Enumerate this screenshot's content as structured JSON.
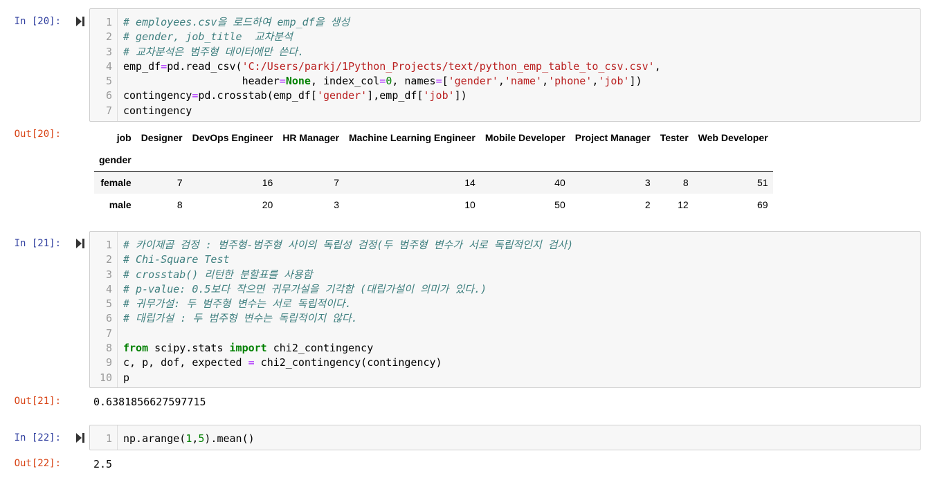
{
  "cells": [
    {
      "in_prompt": "In [20]:",
      "out_prompt": "Out[20]:",
      "lines": [
        {
          "n": "1",
          "parts": [
            {
              "t": "# employees.csv을 로드하여 emp_df을 생성",
              "c": "c-comment"
            }
          ]
        },
        {
          "n": "2",
          "parts": [
            {
              "t": "# gender, job_title  교차분석",
              "c": "c-comment"
            }
          ]
        },
        {
          "n": "3",
          "parts": [
            {
              "t": "# 교차분석은 범주형 데이터에만 쓴다.",
              "c": "c-comment"
            }
          ]
        },
        {
          "n": "4",
          "parts": [
            {
              "t": "emp_df",
              "c": ""
            },
            {
              "t": "=",
              "c": "c-op"
            },
            {
              "t": "pd.read_csv(",
              "c": ""
            },
            {
              "t": "'C:/Users/parkj/1Python_Projects/text/python_emp_table_to_csv.csv'",
              "c": "c-string"
            },
            {
              "t": ",",
              "c": ""
            }
          ]
        },
        {
          "n": "5",
          "parts": [
            {
              "t": "                   header",
              "c": ""
            },
            {
              "t": "=",
              "c": "c-op"
            },
            {
              "t": "None",
              "c": "c-keyword"
            },
            {
              "t": ", index_col",
              "c": ""
            },
            {
              "t": "=",
              "c": "c-op"
            },
            {
              "t": "0",
              "c": "c-number"
            },
            {
              "t": ", names",
              "c": ""
            },
            {
              "t": "=",
              "c": "c-op"
            },
            {
              "t": "[",
              "c": ""
            },
            {
              "t": "'gender'",
              "c": "c-string"
            },
            {
              "t": ",",
              "c": ""
            },
            {
              "t": "'name'",
              "c": "c-string"
            },
            {
              "t": ",",
              "c": ""
            },
            {
              "t": "'phone'",
              "c": "c-string"
            },
            {
              "t": ",",
              "c": ""
            },
            {
              "t": "'job'",
              "c": "c-string"
            },
            {
              "t": "])",
              "c": ""
            }
          ]
        },
        {
          "n": "6",
          "parts": [
            {
              "t": "contingency",
              "c": ""
            },
            {
              "t": "=",
              "c": "c-op"
            },
            {
              "t": "pd.crosstab(emp_df[",
              "c": ""
            },
            {
              "t": "'gender'",
              "c": "c-string"
            },
            {
              "t": "],emp_df[",
              "c": ""
            },
            {
              "t": "'job'",
              "c": "c-string"
            },
            {
              "t": "])",
              "c": ""
            }
          ]
        },
        {
          "n": "7",
          "parts": [
            {
              "t": "contingency",
              "c": ""
            }
          ]
        }
      ]
    },
    {
      "in_prompt": "In [21]:",
      "out_prompt": "Out[21]:",
      "output": "0.6381856627597715",
      "lines": [
        {
          "n": "1",
          "parts": [
            {
              "t": "# 카이제곱 검정 : 범주형-범주형 사이의 독립성 검정(두 범주형 변수가 서로 독립적인지 검사)",
              "c": "c-comment"
            }
          ]
        },
        {
          "n": "2",
          "parts": [
            {
              "t": "# Chi-Square Test",
              "c": "c-comment"
            }
          ]
        },
        {
          "n": "3",
          "parts": [
            {
              "t": "# crosstab() 리턴한 분할표를 사용함",
              "c": "c-comment"
            }
          ]
        },
        {
          "n": "4",
          "parts": [
            {
              "t": "# p-value: 0.5보다 작으면 귀무가설을 기각함 (대립가설이 의미가 있다.)",
              "c": "c-comment"
            }
          ]
        },
        {
          "n": "5",
          "parts": [
            {
              "t": "# 귀무가설: 두 범주형 변수는 서로 독립적이다.",
              "c": "c-comment"
            }
          ]
        },
        {
          "n": "6",
          "parts": [
            {
              "t": "# 대립가설 : 두 범주형 변수는 독립적이지 않다.",
              "c": "c-comment"
            }
          ]
        },
        {
          "n": "7",
          "parts": []
        },
        {
          "n": "8",
          "parts": [
            {
              "t": "from",
              "c": "c-keyword"
            },
            {
              "t": " scipy.stats ",
              "c": ""
            },
            {
              "t": "import",
              "c": "c-keyword"
            },
            {
              "t": " chi2_contingency",
              "c": ""
            }
          ]
        },
        {
          "n": "9",
          "parts": [
            {
              "t": "c, p, dof, expected ",
              "c": ""
            },
            {
              "t": "=",
              "c": "c-op"
            },
            {
              "t": " chi2_contingency(contingency)",
              "c": ""
            }
          ]
        },
        {
          "n": "10",
          "parts": [
            {
              "t": "p",
              "c": ""
            }
          ]
        }
      ]
    },
    {
      "in_prompt": "In [22]:",
      "out_prompt": "Out[22]:",
      "output": "2.5",
      "lines": [
        {
          "n": "1",
          "parts": [
            {
              "t": "np.arange(",
              "c": ""
            },
            {
              "t": "1",
              "c": "c-number"
            },
            {
              "t": ",",
              "c": ""
            },
            {
              "t": "5",
              "c": "c-number"
            },
            {
              "t": ").mean()",
              "c": ""
            }
          ]
        }
      ]
    }
  ],
  "dataframe": {
    "columns_name": "job",
    "index_name": "gender",
    "columns": [
      "Designer",
      "DevOps Engineer",
      "HR Manager",
      "Machine Learning Engineer",
      "Mobile Developer",
      "Project Manager",
      "Tester",
      "Web Developer"
    ],
    "rows": [
      {
        "index": "female",
        "values": [
          "7",
          "16",
          "7",
          "14",
          "40",
          "3",
          "8",
          "51"
        ]
      },
      {
        "index": "male",
        "values": [
          "8",
          "20",
          "3",
          "10",
          "50",
          "2",
          "12",
          "69"
        ]
      }
    ]
  },
  "colors": {
    "in_prompt": "#303f9f",
    "out_prompt": "#d84315",
    "comment": "#408080",
    "string": "#ba2121",
    "keyword": "#008000"
  },
  "icons": {
    "run": "step-forward-icon"
  }
}
